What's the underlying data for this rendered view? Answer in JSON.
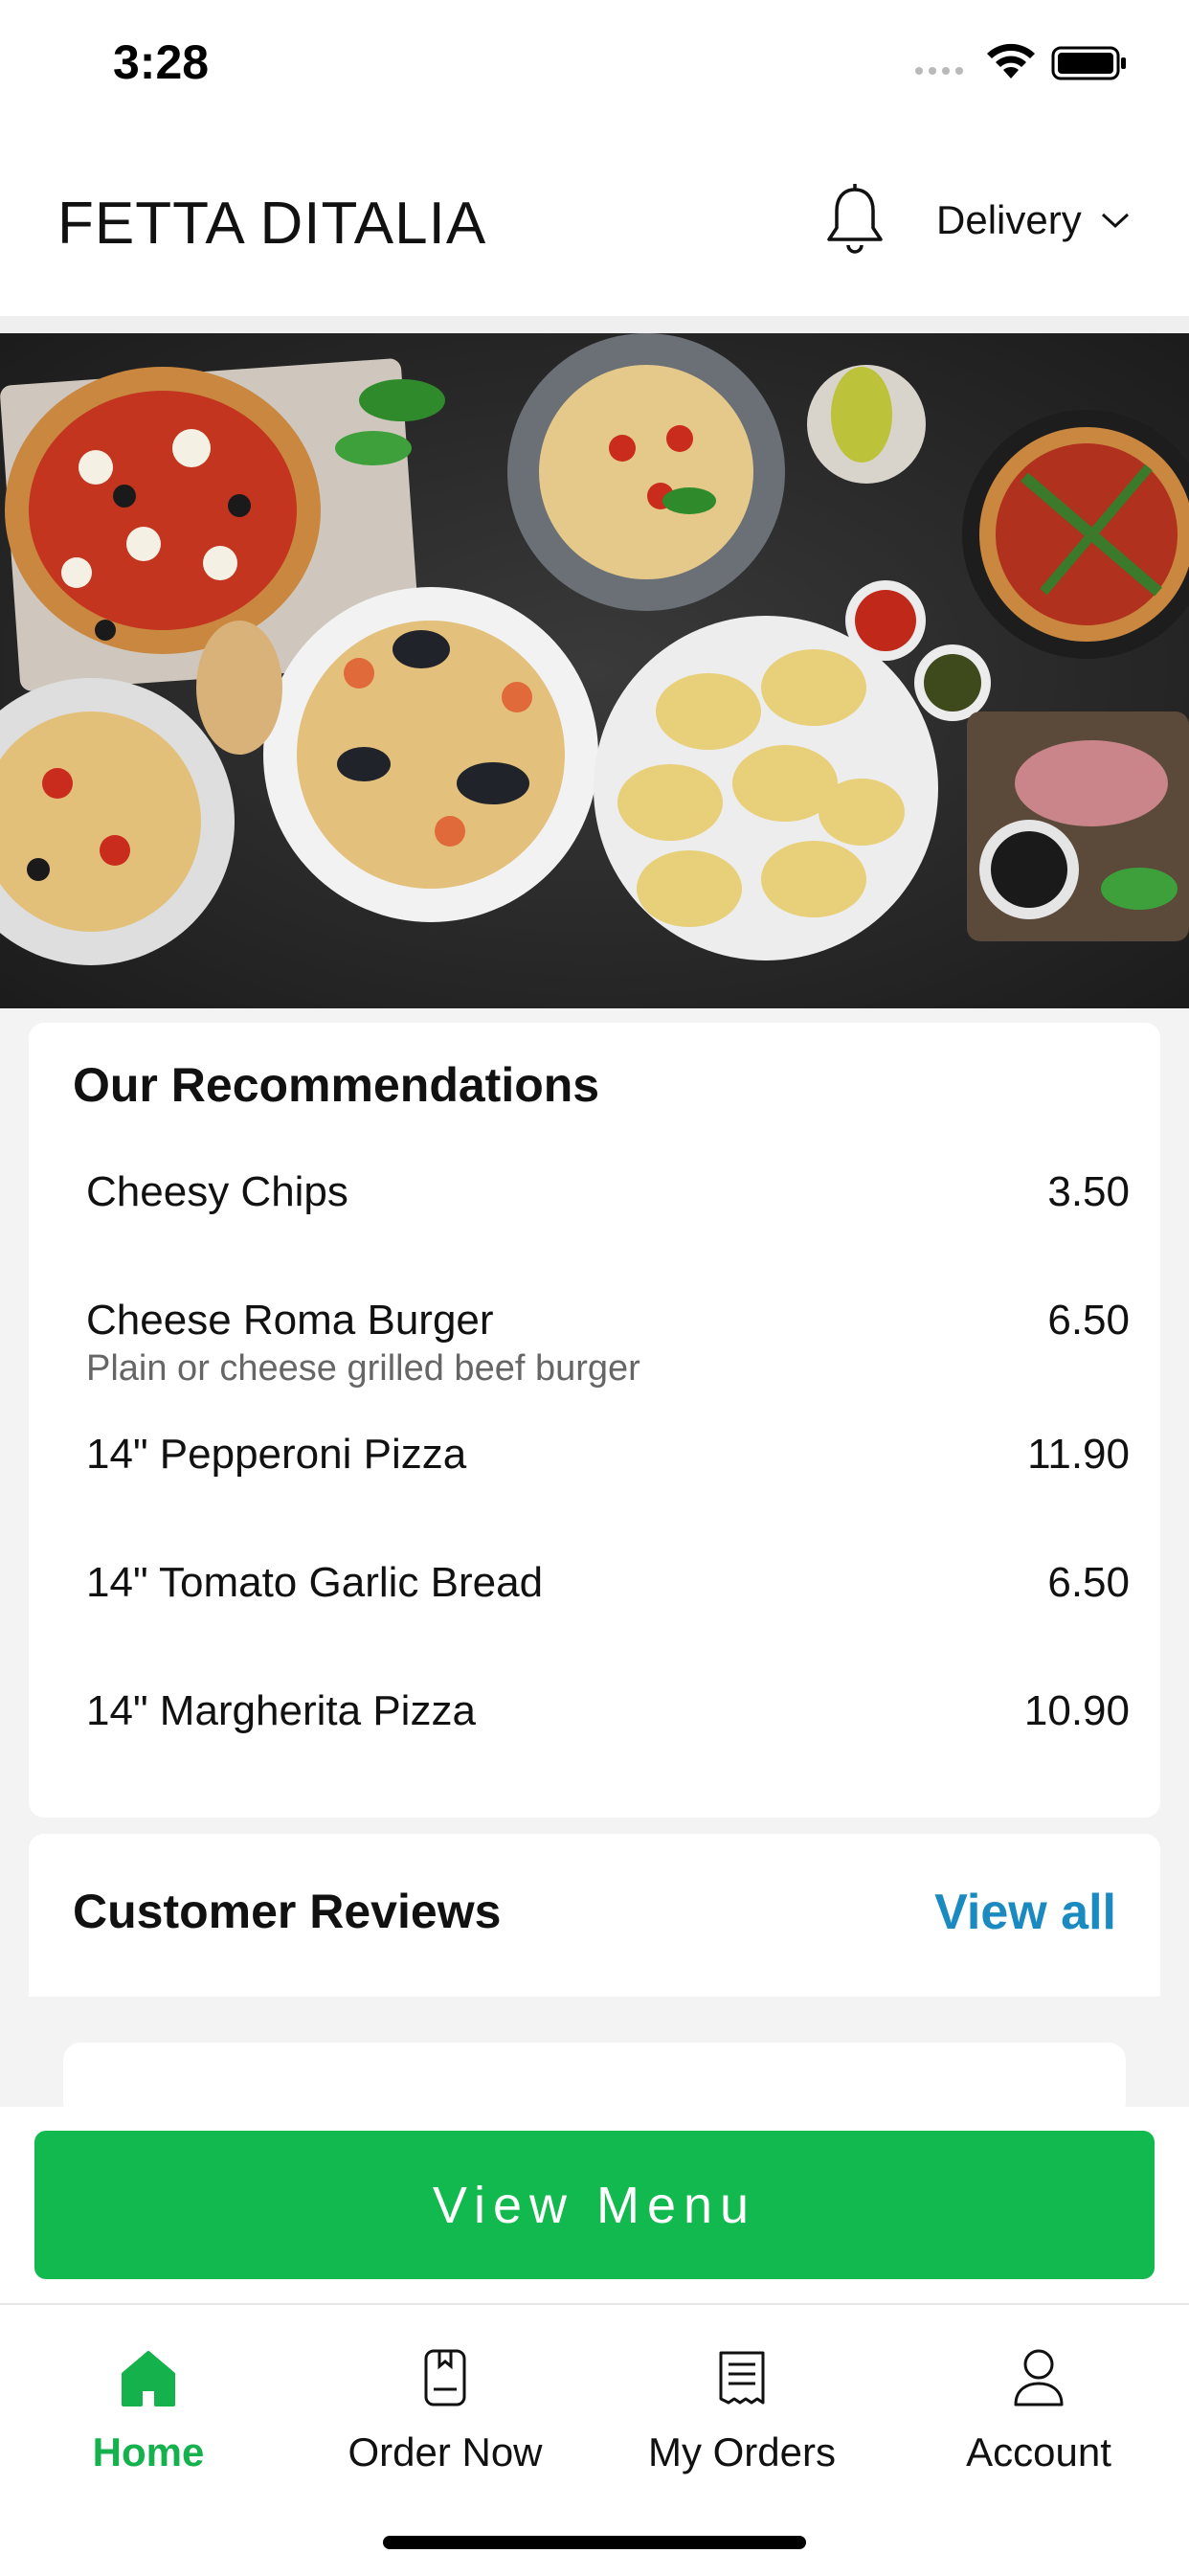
{
  "status_bar": {
    "time": "3:28"
  },
  "header": {
    "brand": "FETTA DITALIA",
    "delivery_mode": "Delivery"
  },
  "recommendations": {
    "title": "Our Recommendations",
    "items": [
      {
        "name": "Cheesy Chips",
        "description": "",
        "price": "3.50"
      },
      {
        "name": "Cheese Roma Burger",
        "description": "Plain or cheese grilled beef burger",
        "price": "6.50"
      },
      {
        "name": "14\" Pepperoni Pizza",
        "description": "",
        "price": "11.90"
      },
      {
        "name": "14\" Tomato Garlic Bread",
        "description": "",
        "price": "6.50"
      },
      {
        "name": "14\" Margherita Pizza",
        "description": "",
        "price": "10.90"
      }
    ]
  },
  "reviews": {
    "title": "Customer Reviews",
    "view_all": "View all"
  },
  "cta": {
    "label": "View Menu"
  },
  "nav": {
    "items": [
      {
        "label": "Home",
        "icon": "home-icon",
        "active": true
      },
      {
        "label": "Order Now",
        "icon": "order-now-icon",
        "active": false
      },
      {
        "label": "My Orders",
        "icon": "receipt-icon",
        "active": false
      },
      {
        "label": "Account",
        "icon": "account-icon",
        "active": false
      }
    ]
  },
  "colors": {
    "accent_green": "#12b94e",
    "link_blue": "#1a8ac0",
    "page_bg": "#f3f3f3"
  }
}
